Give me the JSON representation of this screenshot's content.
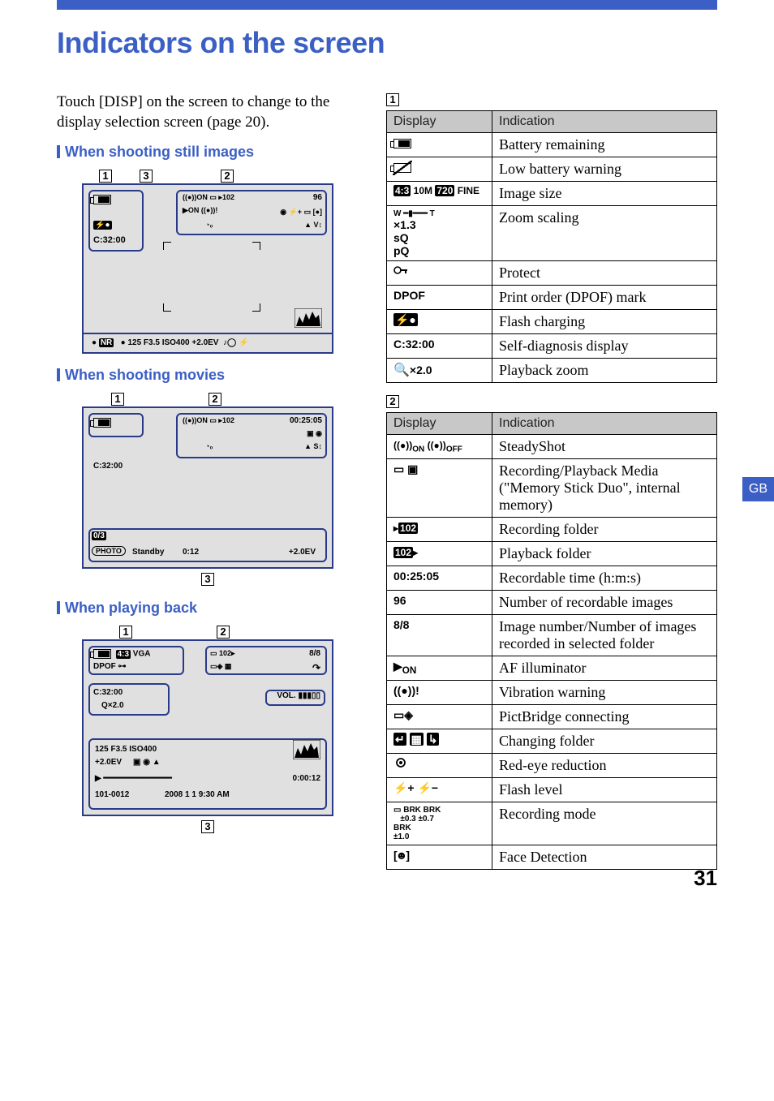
{
  "page": {
    "title": "Indicators on the screen",
    "intro": "Touch [DISP] on the screen to change to the display selection screen (page 20).",
    "number": "31",
    "lang_tab": "GB"
  },
  "sections": {
    "still": "When shooting still images",
    "movies": "When shooting movies",
    "playback": "When playing back"
  },
  "lcd_still": {
    "num_recordable": "96",
    "flash": "C:32:00",
    "bottom": "●     125    F3.5   ISO400   +2.0EV",
    "nr": "NR"
  },
  "lcd_movie": {
    "time": "00:25:05",
    "cdiag": "C:32:00",
    "frac": "0/3",
    "photo": "PHOTO",
    "standby": "Standby",
    "elapsed": "0:12",
    "ev": "+2.0EV"
  },
  "lcd_play": {
    "vga": "VGA",
    "ratio": "4:3",
    "count": "8/8",
    "dpof": "DPOF",
    "cdiag": "C:32:00",
    "zoom": "×2.0",
    "vol": "VOL.",
    "line1": "125    F3.5    ISO400",
    "line2": "+2.0EV",
    "dur": "0:00:12",
    "folder": "101-0012",
    "date": "2008  1  1  9:30 AM"
  },
  "callout_labels": {
    "n1": "1",
    "n2": "2",
    "n3": "3"
  },
  "table_headers": {
    "display": "Display",
    "indication": "Indication"
  },
  "table1": [
    {
      "disp_icon": "battery",
      "disp": "",
      "ind": "Battery remaining"
    },
    {
      "disp_icon": "battery-low",
      "disp": "",
      "ind": "Low battery warning"
    },
    {
      "disp_icon": "",
      "disp": "4:3 10M 720 FINE",
      "ind": "Image size"
    },
    {
      "disp_icon": "zoom",
      "disp": "×1.3\nsQ\npQ",
      "ind": "Zoom scaling"
    },
    {
      "disp_icon": "key",
      "disp": "",
      "ind": "Protect"
    },
    {
      "disp_icon": "",
      "disp": "DPOF",
      "ind": "Print order (DPOF) mark"
    },
    {
      "disp_icon": "flash",
      "disp": "",
      "ind": "Flash charging"
    },
    {
      "disp_icon": "",
      "disp": "C:32:00",
      "ind": "Self-diagnosis display"
    },
    {
      "disp_icon": "",
      "disp": "Q×2.0",
      "ind": "Playback zoom"
    }
  ],
  "table2": [
    {
      "disp_icon": "steady",
      "disp": "",
      "ind": "SteadyShot"
    },
    {
      "disp_icon": "media",
      "disp": "",
      "ind": "Recording/Playback Media (\"Memory Stick Duo\", internal memory)"
    },
    {
      "disp_icon": "recfolder",
      "disp": "",
      "ind": "Recording folder"
    },
    {
      "disp_icon": "playfolder",
      "disp": "",
      "ind": "Playback folder"
    },
    {
      "disp_icon": "",
      "disp": "00:25:05",
      "ind": "Recordable time (h:m:s)"
    },
    {
      "disp_icon": "",
      "disp": "96",
      "ind": "Number of recordable images"
    },
    {
      "disp_icon": "",
      "disp": "8/8",
      "ind": "Image number/Number of images recorded in selected folder"
    },
    {
      "disp_icon": "afill",
      "disp": "",
      "ind": "AF illuminator"
    },
    {
      "disp_icon": "vibwarn",
      "disp": "",
      "ind": "Vibration warning"
    },
    {
      "disp_icon": "pictbridge",
      "disp": "",
      "ind": "PictBridge connecting"
    },
    {
      "disp_icon": "chfolder",
      "disp": "",
      "ind": "Changing folder"
    },
    {
      "disp_icon": "redeye",
      "disp": "",
      "ind": "Red-eye reduction"
    },
    {
      "disp_icon": "flashlevel",
      "disp": "",
      "ind": "Flash level"
    },
    {
      "disp_icon": "brk",
      "disp": "BRK ±0.3  BRK ±0.7  BRK ±1.0",
      "ind": "Recording mode"
    },
    {
      "disp_icon": "facedet",
      "disp": "",
      "ind": "Face Detection"
    }
  ]
}
